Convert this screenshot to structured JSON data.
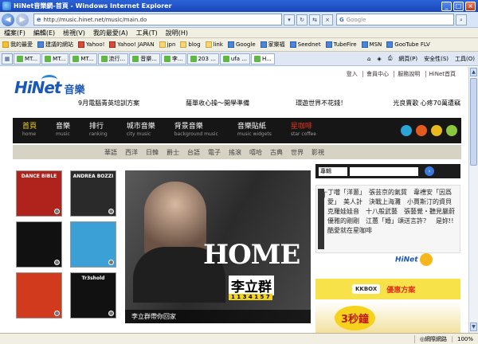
{
  "window": {
    "title": "HiNet音樂網-首頁 - Windows Internet Explorer",
    "min": "_",
    "max": "□",
    "close": "×"
  },
  "address": {
    "url": "http://music.hinet.net/music/main.do",
    "search_placeholder": "Google"
  },
  "menu": [
    "檔案(F)",
    "編輯(E)",
    "檢視(V)",
    "我的最愛(A)",
    "工具(T)",
    "說明(H)"
  ],
  "favorites": [
    {
      "label": "我的最愛",
      "icon": "star"
    },
    {
      "label": "建議的網站",
      "icon": "ie"
    },
    {
      "label": "Yahoo!",
      "icon": "yahoo"
    },
    {
      "label": "Yahoo! JAPAN",
      "icon": "yahoo"
    },
    {
      "label": "jpn",
      "icon": "folder"
    },
    {
      "label": "blog",
      "icon": "folder"
    },
    {
      "label": "link",
      "icon": "folder"
    },
    {
      "label": "Google",
      "icon": "google"
    },
    {
      "label": "家樂福",
      "icon": "page"
    },
    {
      "label": "Seednet",
      "icon": "page"
    },
    {
      "label": "TubeFire",
      "icon": "page"
    },
    {
      "label": "MSN",
      "icon": "page"
    },
    {
      "label": "GooTube FLV",
      "icon": "page"
    }
  ],
  "tabs": [
    {
      "label": "MT...",
      "active": false
    },
    {
      "label": "MT...",
      "active": false
    },
    {
      "label": "MT...",
      "active": false
    },
    {
      "label": "流行...",
      "active": false
    },
    {
      "label": "音樂...",
      "active": false
    },
    {
      "label": "李...",
      "active": false
    },
    {
      "label": "203 ...",
      "active": false
    },
    {
      "label": "ufa ...",
      "active": false
    },
    {
      "label": "H...",
      "active": true
    }
  ],
  "tab_tools": [
    "網頁(P)",
    "安全性(S)",
    "工具(O)"
  ],
  "page": {
    "toplinks": [
      "登入",
      "會員中心",
      "服務說明",
      "HiNet首頁"
    ],
    "logo_text": "HiNet",
    "logo_music": "音樂",
    "taglines": [
      "9月電腦青英培訓方案",
      "薩單收心操～開學準備",
      "環遊世界不花錢！",
      "光良賣歌 心疼70萬遭竊"
    ],
    "nav": [
      {
        "zh": "首頁",
        "en": "home",
        "style": "active"
      },
      {
        "zh": "音樂",
        "en": "music",
        "style": ""
      },
      {
        "zh": "排行",
        "en": "ranking",
        "style": ""
      },
      {
        "zh": "城市音樂",
        "en": "city music",
        "style": ""
      },
      {
        "zh": "背景音樂",
        "en": "background music",
        "style": ""
      },
      {
        "zh": "音樂貼紙",
        "en": "music widgets",
        "style": ""
      },
      {
        "zh": "星咖啡",
        "en": "star coffee",
        "style": "red"
      }
    ],
    "genres": [
      "華語",
      "西洋",
      "日韓",
      "爵士",
      "台語",
      "電子",
      "搖滾",
      "嘻哈",
      "古典",
      "世界",
      "影視"
    ],
    "albums": [
      {
        "label": "DANCE BIBLE",
        "color": "#b0231c"
      },
      {
        "label": "ANDREA BOZZI",
        "color": "#2a2a2a"
      },
      {
        "label": "",
        "color": "#111111"
      },
      {
        "label": "",
        "color": "#3aa0d6"
      },
      {
        "label": "",
        "color": "#d13a1c"
      },
      {
        "label": "Tr3shold",
        "color": "#111111"
      }
    ],
    "feature": {
      "headline": "HOME",
      "artist": "李立群",
      "date": "1 1 3  4 1 5 7",
      "caption": "李立群帶你回家"
    },
    "sidebar": {
      "select_value": "專輯",
      "go_icon": "search-go-icon",
      "news": "丁噹「洋蔥」　張芸京的氣質　韋禮安「因爲愛」　美人計　決戰上海灘　小賈斯汀的資貝　克羅娃娃音　十八般武藝　張藝覺・聽見嚴蔚　優雅的剛剛　江蕙「婚」頌送言許？　是妳!!　酷愛就在星咖啡",
      "hinet_mini": "HiNet",
      "kkbox": "KKBOX",
      "kkbox_offer": "優惠方案",
      "promo": "3秒鐘"
    }
  },
  "status": {
    "zone": "網際網路",
    "zoom": "100%"
  }
}
